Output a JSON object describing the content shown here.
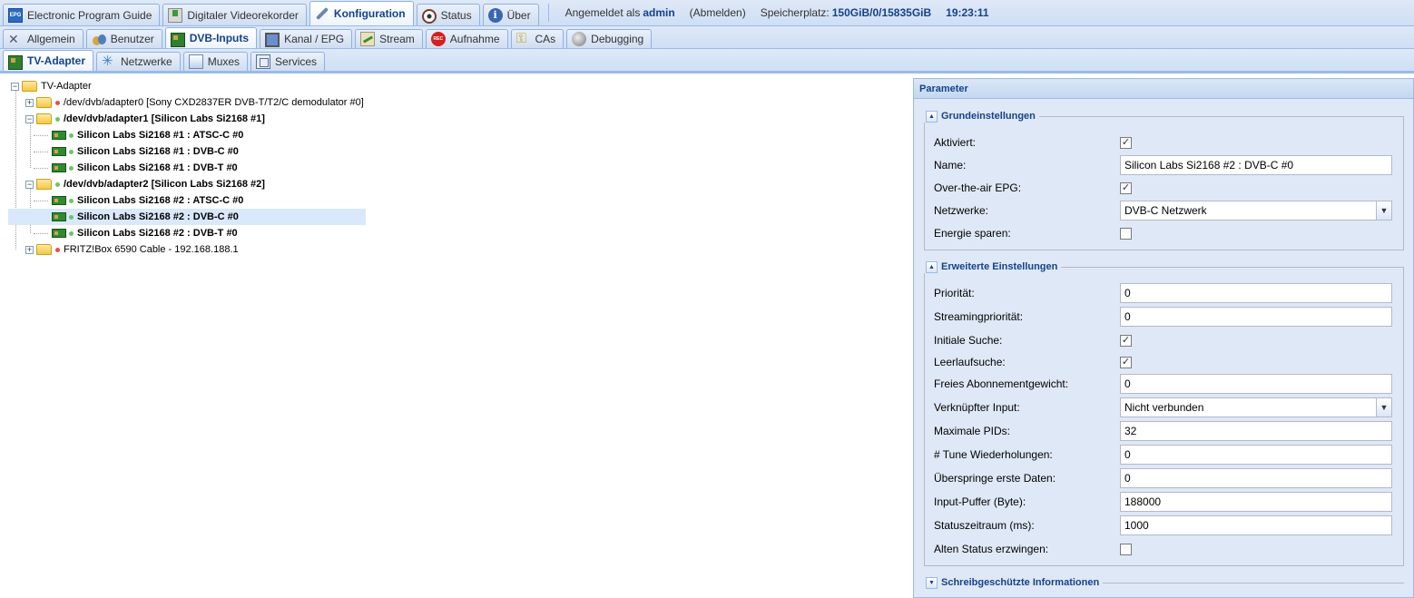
{
  "topbar": {
    "tabs": [
      {
        "label": "Electronic Program Guide",
        "icon": "epg-icon"
      },
      {
        "label": "Digitaler Videorekorder",
        "icon": "recorder-icon"
      },
      {
        "label": "Konfiguration",
        "icon": "wrench-icon",
        "active": true
      },
      {
        "label": "Status",
        "icon": "eye-icon"
      },
      {
        "label": "Über",
        "icon": "info-icon"
      }
    ],
    "logged_in_prefix": "Angemeldet als",
    "user": "admin",
    "logout": "(Abmelden)",
    "storage_label": "Speicherplatz:",
    "storage_value": "150GiB/0/15835GiB",
    "time": "19:23:11"
  },
  "config_tabs": [
    {
      "label": "Allgemein",
      "icon": "tools-icon"
    },
    {
      "label": "Benutzer",
      "icon": "users-icon"
    },
    {
      "label": "DVB-Inputs",
      "icon": "card-icon",
      "active": true
    },
    {
      "label": "Kanal / EPG",
      "icon": "tv-icon"
    },
    {
      "label": "Stream",
      "icon": "stream-icon"
    },
    {
      "label": "Aufnahme",
      "icon": "rec-icon"
    },
    {
      "label": "CAs",
      "icon": "key-icon"
    },
    {
      "label": "Debugging",
      "icon": "debug-icon"
    }
  ],
  "dvb_tabs": [
    {
      "label": "TV-Adapter",
      "icon": "card-icon",
      "active": true
    },
    {
      "label": "Netzwerke",
      "icon": "network-icon"
    },
    {
      "label": "Muxes",
      "icon": "mux-icon"
    },
    {
      "label": "Services",
      "icon": "services-icon"
    }
  ],
  "tree": {
    "root": "TV-Adapter",
    "nodes": [
      {
        "label": "/dev/dvb/adapter0 [Sony CXD2837ER DVB-T/T2/C demodulator #0]",
        "status": "red",
        "expanded": false,
        "bold": false
      },
      {
        "label": "/dev/dvb/adapter1 [Silicon Labs Si2168 #1]",
        "status": "green",
        "expanded": true,
        "bold": true
      },
      {
        "label": "Silicon Labs Si2168 #1 : ATSC-C #0",
        "status": "green",
        "bold": true
      },
      {
        "label": "Silicon Labs Si2168 #1 : DVB-C #0",
        "status": "green",
        "bold": true
      },
      {
        "label": "Silicon Labs Si2168 #1 : DVB-T #0",
        "status": "green",
        "bold": true
      },
      {
        "label": "/dev/dvb/adapter2 [Silicon Labs Si2168 #2]",
        "status": "green",
        "expanded": true,
        "bold": true
      },
      {
        "label": "Silicon Labs Si2168 #2 : ATSC-C #0",
        "status": "green",
        "bold": true
      },
      {
        "label": "Silicon Labs Si2168 #2 : DVB-C #0",
        "status": "green",
        "bold": true,
        "selected": true
      },
      {
        "label": "Silicon Labs Si2168 #2 : DVB-T #0",
        "status": "green",
        "bold": true
      },
      {
        "label": "FRITZ!Box 6590 Cable - 192.168.188.1",
        "status": "red",
        "expanded": false,
        "bold": false
      }
    ]
  },
  "panel": {
    "title": "Parameter",
    "basic": {
      "legend": "Grundeinstellungen",
      "fields": [
        {
          "label": "Aktiviert:",
          "type": "checkbox",
          "checked": true
        },
        {
          "label": "Name:",
          "type": "text",
          "value": "Silicon Labs Si2168 #2 : DVB-C #0"
        },
        {
          "label": "Over-the-air EPG:",
          "type": "checkbox",
          "checked": true
        },
        {
          "label": "Netzwerke:",
          "type": "combo",
          "value": "DVB-C Netzwerk"
        },
        {
          "label": "Energie sparen:",
          "type": "checkbox",
          "checked": false
        }
      ]
    },
    "advanced": {
      "legend": "Erweiterte Einstellungen",
      "fields": [
        {
          "label": "Priorität:",
          "type": "text",
          "value": "0"
        },
        {
          "label": "Streamingpriorität:",
          "type": "text",
          "value": "0"
        },
        {
          "label": "Initiale Suche:",
          "type": "checkbox",
          "checked": true
        },
        {
          "label": "Leerlaufsuche:",
          "type": "checkbox",
          "checked": true
        },
        {
          "label": "Freies Abonnementgewicht:",
          "type": "text",
          "value": "0"
        },
        {
          "label": "Verknüpfter Input:",
          "type": "combo",
          "value": "Nicht verbunden"
        },
        {
          "label": "Maximale PIDs:",
          "type": "text",
          "value": "32"
        },
        {
          "label": "# Tune Wiederholungen:",
          "type": "text",
          "value": "0"
        },
        {
          "label": "Überspringe erste Daten:",
          "type": "text",
          "value": "0"
        },
        {
          "label": "Input-Puffer (Byte):",
          "type": "text",
          "value": "188000"
        },
        {
          "label": "Statuszeitraum (ms):",
          "type": "text",
          "value": "1000"
        },
        {
          "label": "Alten Status erzwingen:",
          "type": "checkbox",
          "checked": false
        }
      ]
    },
    "readonly": {
      "legend": "Schreibgeschützte Informationen"
    }
  }
}
